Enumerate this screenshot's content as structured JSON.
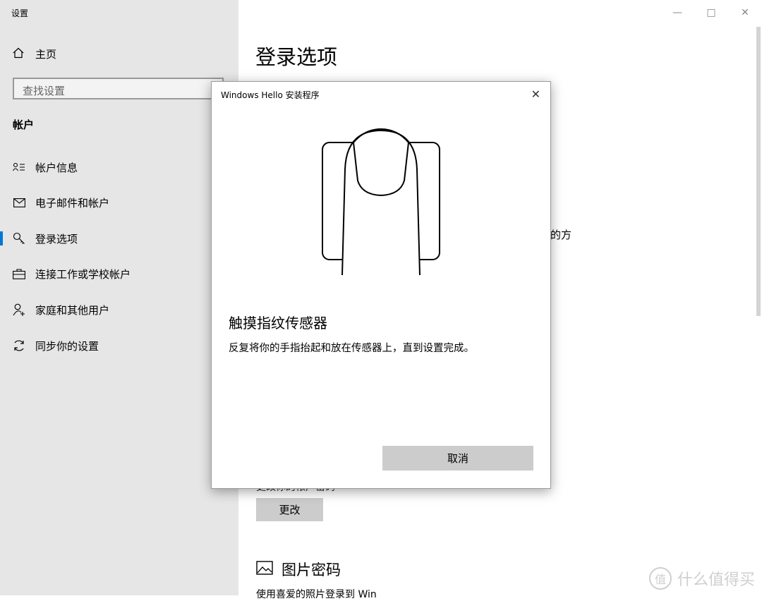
{
  "window": {
    "title": "设置"
  },
  "sidebar": {
    "home_label": "主页",
    "search_placeholder": "查找设置",
    "section": "帐户",
    "items": [
      {
        "label": "帐户信息",
        "icon": "account-info-icon"
      },
      {
        "label": "电子邮件和帐户",
        "icon": "mail-icon"
      },
      {
        "label": "登录选项",
        "icon": "key-icon"
      },
      {
        "label": "连接工作或学校帐户",
        "icon": "briefcase-icon"
      },
      {
        "label": "家庭和其他用户",
        "icon": "add-user-icon"
      },
      {
        "label": "同步你的设置",
        "icon": "sync-icon"
      }
    ]
  },
  "main": {
    "title": "登录选项",
    "partial_text": "的方",
    "change_label_partial": "更改你的帐户密码",
    "change_button": "更改",
    "picture_password_title": "图片密码",
    "picture_password_desc": "使用喜爱的照片登录到 Win"
  },
  "dialog": {
    "title": "Windows Hello 安装程序",
    "heading": "触摸指纹传感器",
    "body": "反复将你的手指抬起和放在传感器上，直到设置完成。",
    "cancel": "取消"
  },
  "watermark": {
    "text": "什么值得买",
    "logo_char": "值"
  },
  "colors": {
    "accent": "#0078d7",
    "sidebar_bg": "#e6e6e6",
    "button_bg": "#cccccc"
  }
}
